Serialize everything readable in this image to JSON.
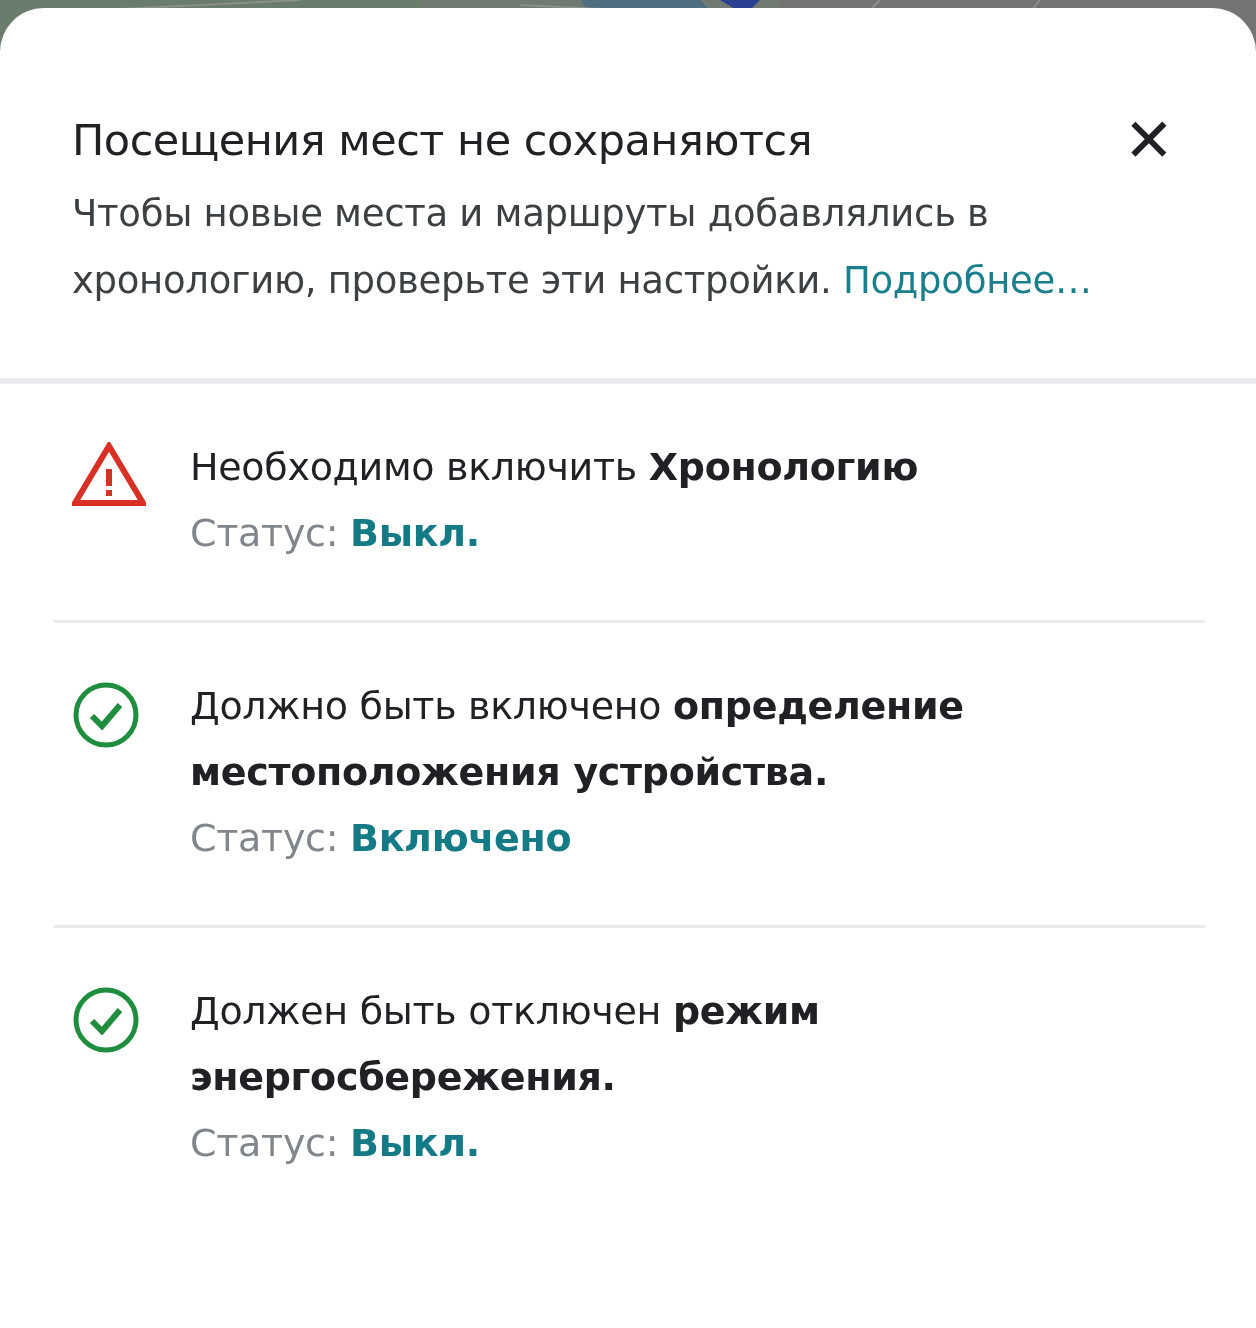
{
  "sheet": {
    "title": "Посещения мест не сохраняются",
    "close_icon": "✕",
    "description": "Чтобы новые места и маршруты добавлялись в хронологию, проверьте эти настройки.",
    "learn_more_link": "Подробнее…"
  },
  "requirements": [
    {
      "kind": "warning",
      "text": "Необходимо включить **Хронологию**",
      "status_label": "Статус:",
      "status_value": "Выкл."
    },
    {
      "kind": "ok",
      "text": "Должно быть включено **определение местоположения устройства.**",
      "status_label": "Статус:",
      "status_value": "Включено"
    },
    {
      "kind": "ok",
      "text": "Должен быть отключен **режим энергосбережения.**",
      "status_label": "Статус:",
      "status_value": "Выкл."
    }
  ]
}
